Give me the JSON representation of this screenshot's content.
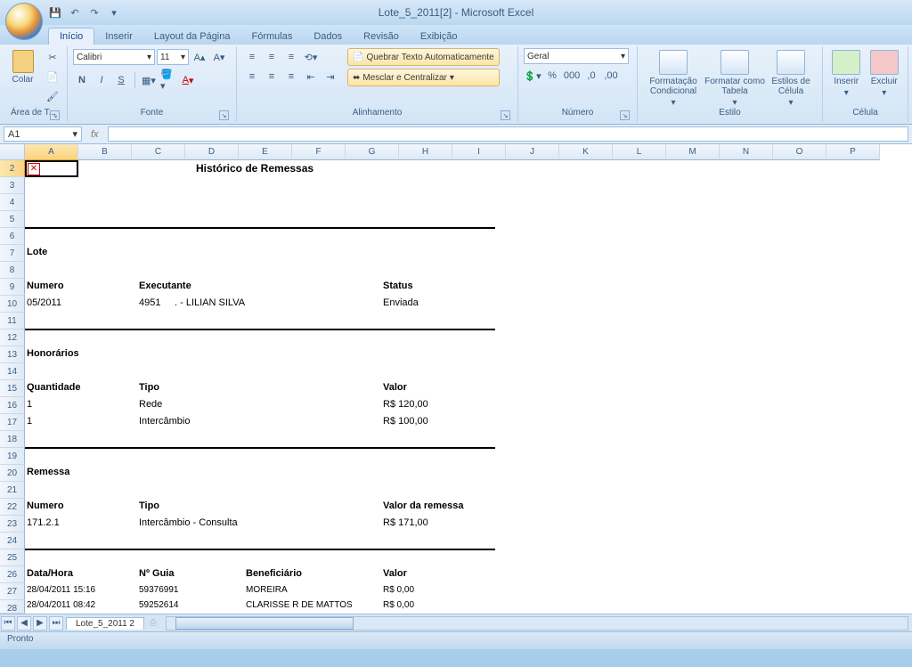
{
  "app": {
    "title": "Lote_5_2011[2] - Microsoft Excel"
  },
  "qat": {
    "save": "💾",
    "undo": "↶",
    "redo": "↷",
    "more": "▾"
  },
  "tabs": [
    "Início",
    "Inserir",
    "Layout da Página",
    "Fórmulas",
    "Dados",
    "Revisão",
    "Exibição"
  ],
  "ribbon": {
    "clipboard": {
      "name": "Área de T...",
      "paste": "Colar"
    },
    "font": {
      "name": "Fonte",
      "family": "Calibri",
      "size": "11",
      "bold": "N",
      "italic": "I",
      "underline": "S"
    },
    "align": {
      "name": "Alinhamento",
      "wrap": "Quebrar Texto Automaticamente",
      "merge": "Mesclar e Centralizar"
    },
    "number": {
      "name": "Número",
      "format": "Geral",
      "pct": "%",
      "sep": "000",
      "inc": ",0",
      "dec": ",00"
    },
    "styles": {
      "name": "Estilo",
      "cf": "Formatação Condicional",
      "ft": "Formatar como Tabela",
      "cs": "Estilos de Célula"
    },
    "cells": {
      "name": "Célula",
      "insert": "Inserir",
      "delete": "Excluir"
    }
  },
  "formula": {
    "namebox": "A1",
    "fx": "fx"
  },
  "columns": [
    "A",
    "B",
    "C",
    "D",
    "E",
    "F",
    "G",
    "H",
    "I",
    "J",
    "K",
    "L",
    "M",
    "N",
    "O",
    "P"
  ],
  "rows": [
    2,
    3,
    4,
    5,
    6,
    7,
    8,
    9,
    10,
    11,
    12,
    13,
    14,
    15,
    16,
    17,
    18,
    19,
    20,
    21,
    22,
    23,
    24,
    25,
    26,
    27,
    28
  ],
  "sheet": {
    "title": "Histórico de Remessas",
    "s1": "Lote",
    "h1": {
      "a": "Numero",
      "b": "Executante",
      "c": "Status"
    },
    "r1": {
      "a": "05/2011",
      "b1": "4951",
      "b2": ". - LILIAN SILVA",
      "c": "Enviada"
    },
    "s2": "Honorários",
    "h2": {
      "a": "Quantidade",
      "b": "Tipo",
      "c": "Valor"
    },
    "r2": {
      "a": "1",
      "b": "Rede",
      "c": "R$ 120,00"
    },
    "r3": {
      "a": "1",
      "b": "Intercâmbio",
      "c": "R$ 100,00"
    },
    "s3": "Remessa",
    "h3": {
      "a": "Numero",
      "b": "Tipo",
      "c": "Valor da remessa"
    },
    "r4": {
      "a": "171.2.1",
      "b": "Intercâmbio - Consulta",
      "c": "R$ 171,00"
    },
    "h4": {
      "a": "Data/Hora",
      "b": "Nº Guia",
      "c": "Beneficiário",
      "d": "Valor"
    },
    "r5": {
      "a": "28/04/2011 15:16",
      "b": "59376991",
      "c": "MOREIRA",
      "d": "R$ 0,00"
    },
    "r6": {
      "a": "28/04/2011 08:42",
      "b": "59252614",
      "c": "CLARISSE R DE MATTOS",
      "d": "R$ 0,00"
    }
  },
  "sheettab": "Lote_5_2011 2",
  "status": "Pronto"
}
